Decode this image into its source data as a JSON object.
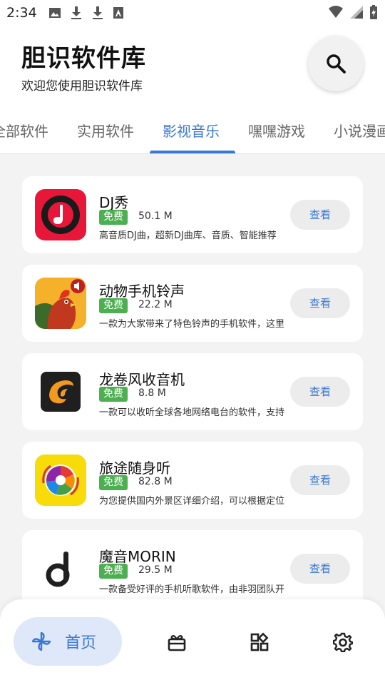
{
  "status_bar": {
    "time": "2:34"
  },
  "header": {
    "title": "胆识软件库",
    "subtitle": "欢迎您使用胆识软件库"
  },
  "tabs": [
    {
      "label": "全部软件",
      "active": false
    },
    {
      "label": "实用软件",
      "active": false
    },
    {
      "label": "影视音乐",
      "active": true
    },
    {
      "label": "嘿嘿游戏",
      "active": false
    },
    {
      "label": "小说漫画",
      "active": false
    }
  ],
  "apps": [
    {
      "name": "DJ秀",
      "badge": "免费",
      "size": "50.1 M",
      "description": "高音质DJ曲，超新DJ曲库、音质、智能推荐",
      "button": "查看",
      "icon": "dj-show-icon"
    },
    {
      "name": "动物手机铃声",
      "badge": "免费",
      "size": "22.2 M",
      "description": "一款为大家带来了特色铃声的手机软件，这里",
      "button": "查看",
      "icon": "rooster-ringtone-icon"
    },
    {
      "name": "龙卷风收音机",
      "badge": "免费",
      "size": "8.8 M",
      "description": "一款可以收听全球各地网络电台的软件，支持",
      "button": "查看",
      "icon": "tornado-radio-icon"
    },
    {
      "name": "旅途随身听",
      "badge": "免费",
      "size": "82.8 M",
      "description": "为您提供国内外景区详细介绍，可以根据定位",
      "button": "查看",
      "icon": "travel-listen-icon"
    },
    {
      "name": "魔音MORIN",
      "badge": "免费",
      "size": "29.5 M",
      "description": "一款备受好评的手机听歌软件，由非羽团队开",
      "button": "查看",
      "icon": "morin-music-icon"
    }
  ],
  "bottom_nav": {
    "home_label": "首页"
  },
  "colors": {
    "accent": "#3a78d6",
    "badge_green": "#4caf50",
    "background": "#f3f3f3"
  }
}
